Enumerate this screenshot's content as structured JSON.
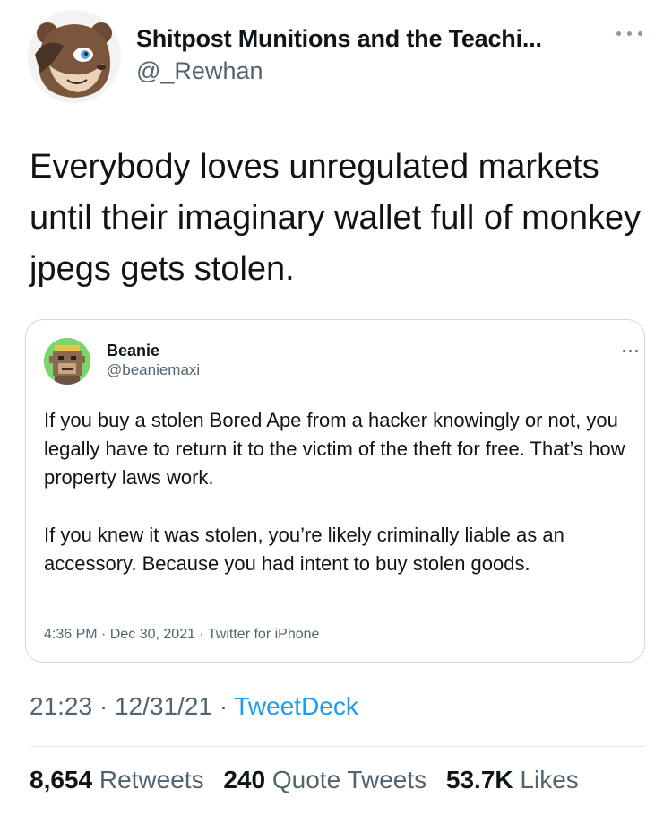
{
  "author": {
    "display_name": "Shitpost Munitions and the Teachi...",
    "handle": "@_Rewhan",
    "avatar_icon": "cartoon-bear-avatar",
    "more_icon": "more-options-icon"
  },
  "tweet": {
    "text": "Everybody loves unregulated markets until their imaginary wallet full of monkey jpegs gets stolen."
  },
  "quoted_tweet": {
    "display_name": "Beanie",
    "handle": "@beaniemaxi",
    "avatar_icon": "pixel-ape-avatar",
    "paragraph1": "If you buy a stolen Bored Ape from a hacker knowingly or not, you legally have to return it to the victim of the theft for free. That’s how property laws work.",
    "paragraph2": "If you knew it was stolen, you’re likely criminally liable as an accessory. Because you had intent to buy stolen goods.",
    "meta": "4:36 PM · Dec 30, 2021 · Twitter for iPhone"
  },
  "meta": {
    "time": "21:23",
    "date": "12/31/21",
    "separator": "·",
    "source": "TweetDeck"
  },
  "stats": {
    "retweets_count": "8,654",
    "retweets_label": "Retweets",
    "quotes_count": "240",
    "quotes_label": "Quote Tweets",
    "likes_count": "53.7K",
    "likes_label": "Likes"
  },
  "colors": {
    "text_primary": "#0f1419",
    "text_secondary": "#536471",
    "link": "#1d9bf0",
    "border": "#cfd9de"
  }
}
